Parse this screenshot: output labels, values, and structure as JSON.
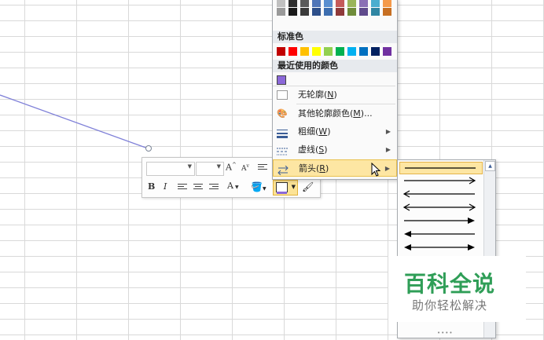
{
  "menu": {
    "standard_colors_label": "标准色",
    "recent_colors_label": "最近使用的颜色",
    "recent_color": "#8b68d9",
    "theme_colors": [
      [
        "#c0c0c0",
        "#9a9a9a"
      ],
      [
        "#303030",
        "#1a1a1a"
      ],
      [
        "#5a5a5a",
        "#3a3a3a"
      ],
      [
        "#4f75b8",
        "#2d4f8a"
      ],
      [
        "#5a8fd0",
        "#3d6eb0"
      ],
      [
        "#c55a5a",
        "#8f3a3a"
      ],
      [
        "#9ab55a",
        "#6f8c3a"
      ],
      [
        "#8a6fb5",
        "#5f4a8c"
      ],
      [
        "#4aaecf",
        "#2f86a3"
      ],
      [
        "#f59a4a",
        "#c76f22"
      ]
    ],
    "standard_colors": [
      "#c00000",
      "#ff0000",
      "#ffc000",
      "#ffff00",
      "#92d050",
      "#00b050",
      "#00b0f0",
      "#0070c0",
      "#002060",
      "#7030a0"
    ],
    "items": [
      {
        "label": "无轮廓(N)",
        "text": "无轮廓(",
        "key": "N",
        "tail": ")"
      },
      {
        "label": "其他轮廓颜色(M)...",
        "text": "其他轮廓颜色(",
        "key": "M",
        "tail": ")..."
      },
      {
        "label": "粗细(W)",
        "text": "粗细(",
        "key": "W",
        "tail": ")"
      },
      {
        "label": "虚线(S)",
        "text": "虚线(",
        "key": "S",
        "tail": ")"
      },
      {
        "label": "箭头(R)",
        "text": "箭头(",
        "key": "R",
        "tail": ")"
      }
    ]
  },
  "toolbar": {
    "font_value": "",
    "size_value": "",
    "grow_font": "A",
    "shrink_font": "A",
    "bold": "B",
    "italic": "I",
    "font_color": "A",
    "accent_color": "#8b68d9"
  },
  "arrow_styles": [
    "line",
    "right",
    "left",
    "left-right",
    "right-solid",
    "left-solid",
    "both-solid"
  ],
  "watermark": {
    "title": "百科全说",
    "subtitle": "助你轻松解决"
  }
}
